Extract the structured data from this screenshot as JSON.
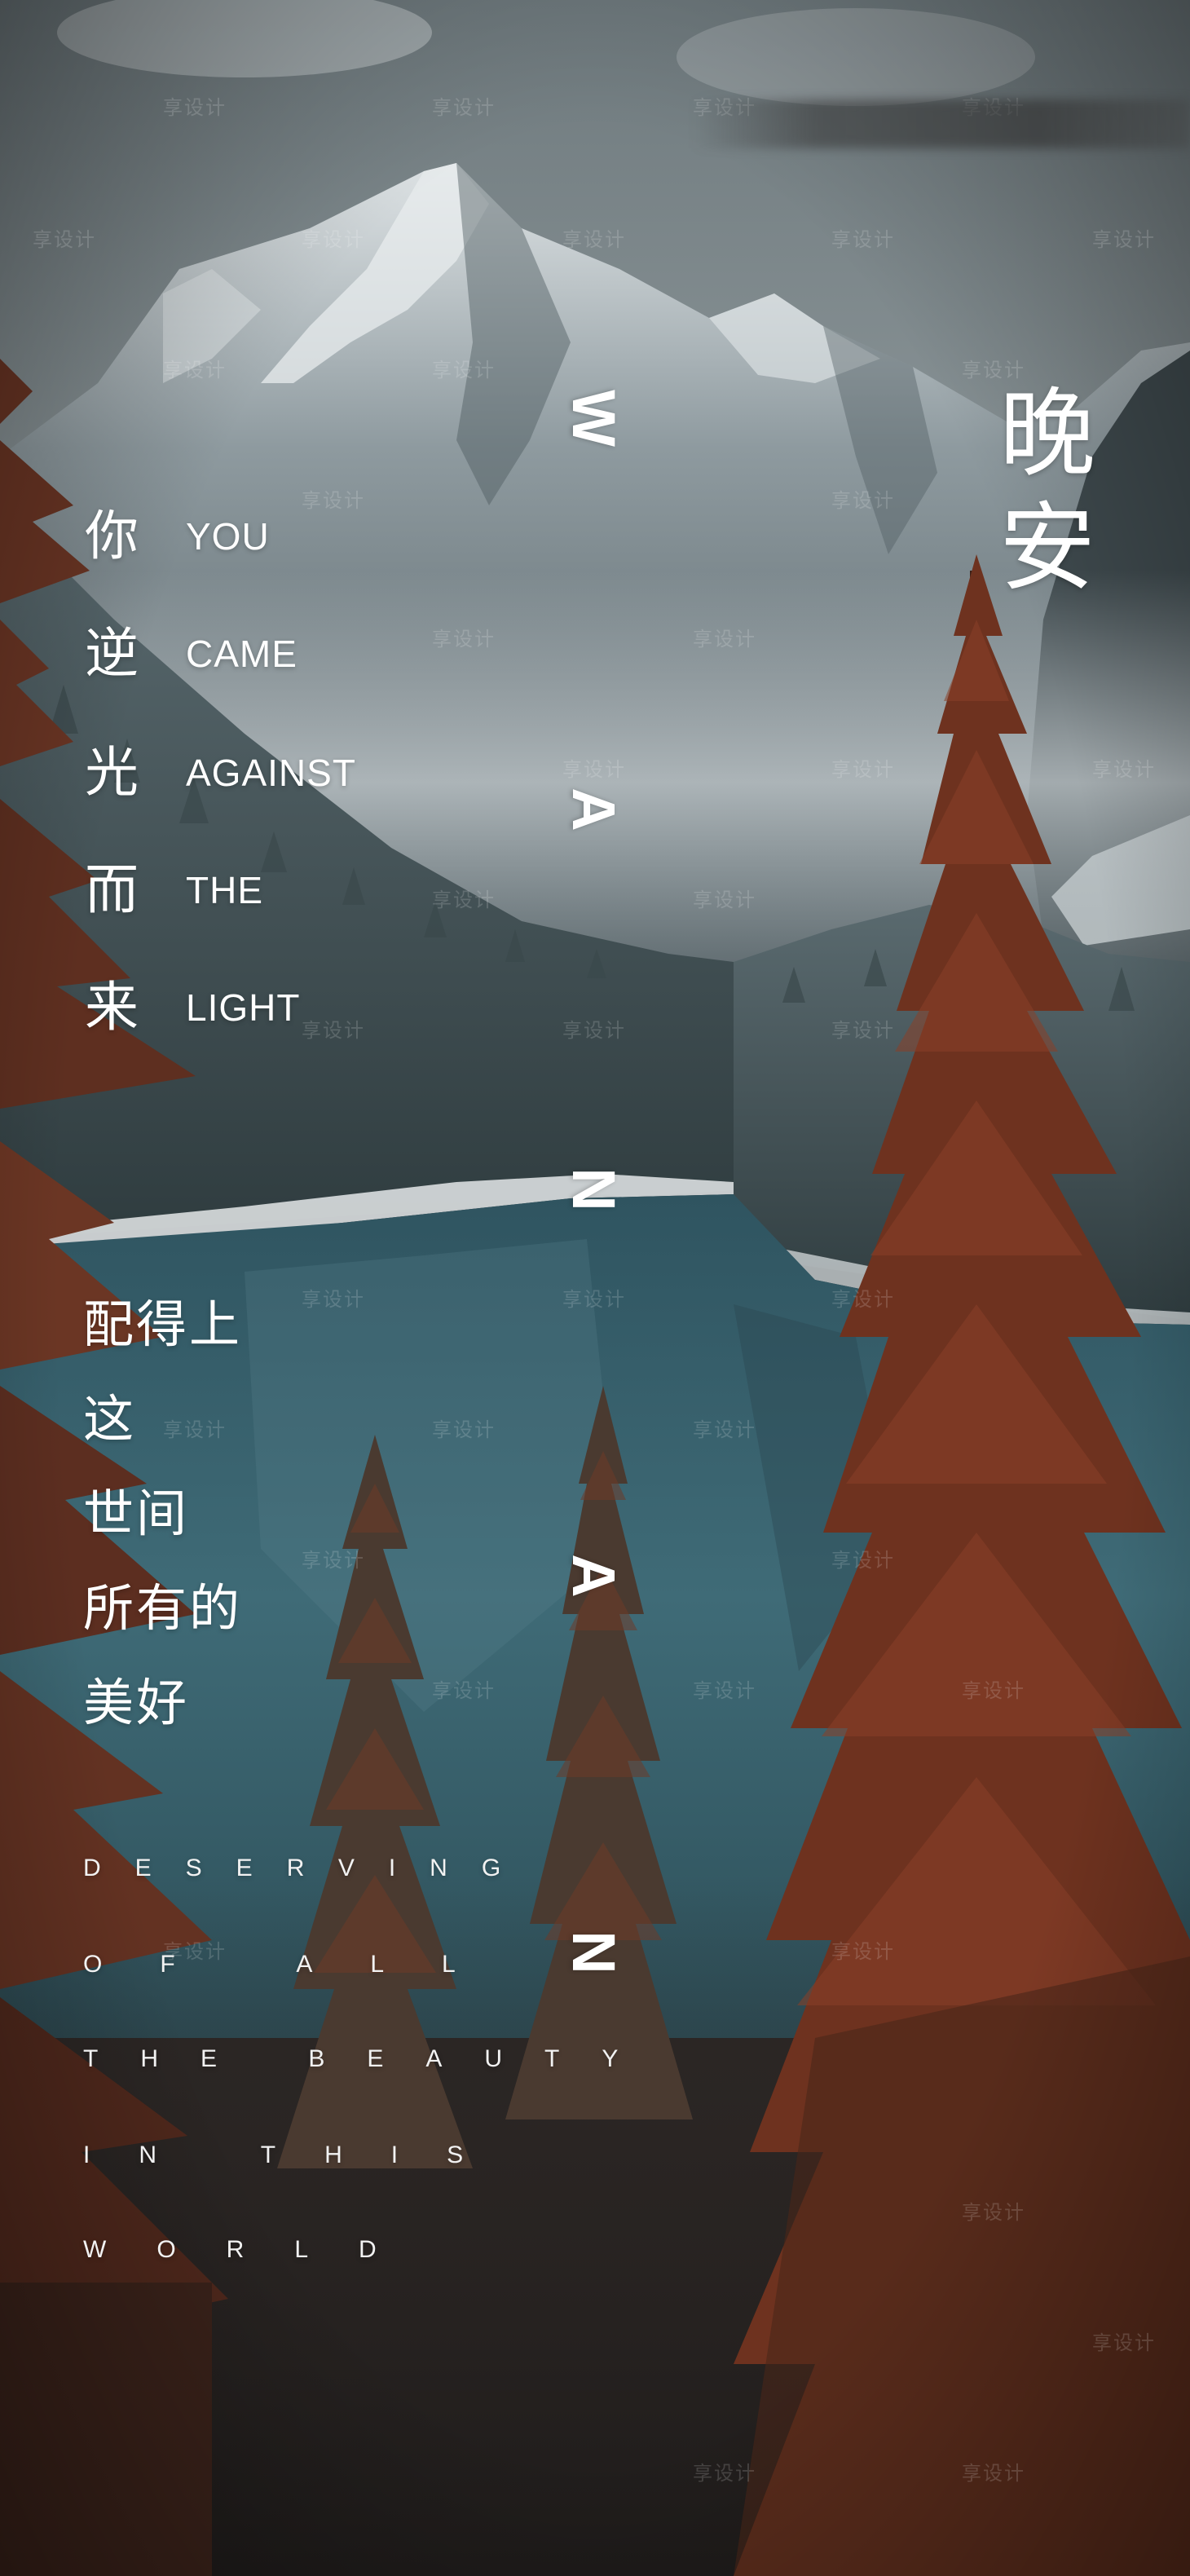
{
  "headline": [
    "晚",
    "安"
  ],
  "title_pairs": [
    {
      "cn": "你",
      "en": "YOU"
    },
    {
      "cn": "逆",
      "en": "CAME"
    },
    {
      "cn": "光",
      "en": "AGAINST"
    },
    {
      "cn": "而",
      "en": "THE"
    },
    {
      "cn": "来",
      "en": "LIGHT"
    }
  ],
  "wan_letters": [
    "W",
    "A",
    "N",
    "A",
    "N"
  ],
  "body_cn": [
    "配得上",
    "这",
    "世间",
    "所有的",
    "美好"
  ],
  "body_en": [
    "DESERVING",
    "OF ALL",
    "THE BEAUTY",
    "IN THIS",
    "WORLD"
  ],
  "watermark": "享设计",
  "colors": {
    "sky": "#7d888c",
    "mountain": "#5f6c72",
    "snow": "#d9dee0",
    "lake": "#3d6672",
    "forest": "#2d3a3c",
    "tree_red": "#7a3a26",
    "text": "#ffffff"
  }
}
